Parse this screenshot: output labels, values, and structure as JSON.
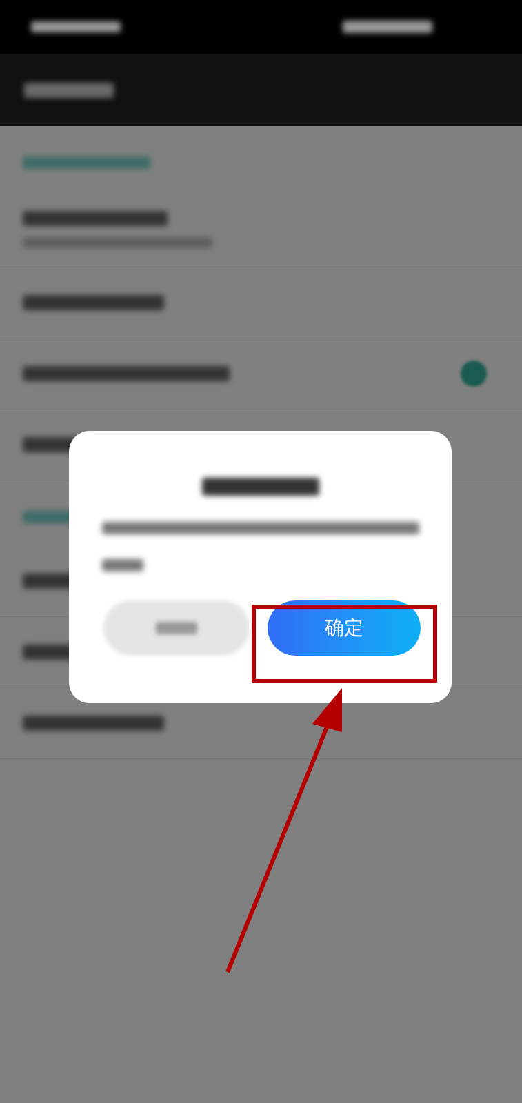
{
  "settings_rows": [
    {
      "kind": "header"
    },
    {
      "kind": "two-line"
    },
    {
      "kind": "plain"
    },
    {
      "kind": "toggle",
      "on": true
    },
    {
      "kind": "plain"
    },
    {
      "kind": "header"
    },
    {
      "kind": "plain"
    },
    {
      "kind": "plain"
    },
    {
      "kind": "plain"
    }
  ],
  "dialog": {
    "confirm_button": "确定"
  }
}
